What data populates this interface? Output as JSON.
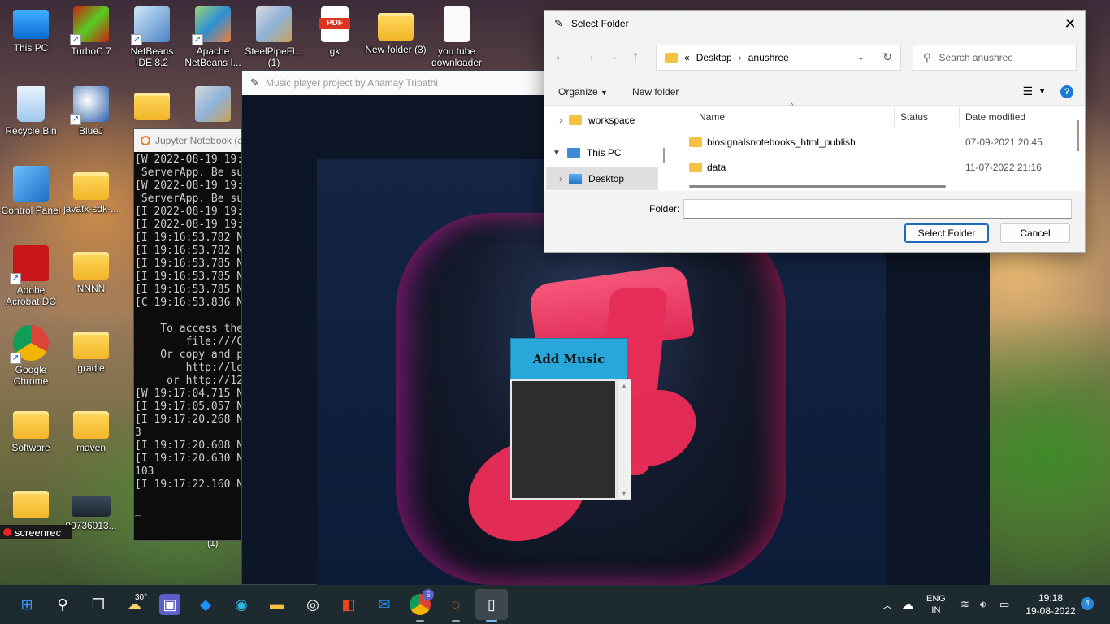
{
  "desktop": {
    "icons": [
      {
        "label": "This PC"
      },
      {
        "label": "TurboC 7"
      },
      {
        "label": "NetBeans IDE 8.2"
      },
      {
        "label": "Apache NetBeans I..."
      },
      {
        "label": "SteelPipeFl... (1)"
      },
      {
        "label": "gk",
        "badge": "PDF"
      },
      {
        "label": "New folder (3)"
      },
      {
        "label": "you tube downloader"
      },
      {
        "label": "Recycle Bin"
      },
      {
        "label": "BlueJ"
      },
      {
        "label": "Control Panel"
      },
      {
        "label": "javafx-sdk-..."
      },
      {
        "label": "Adobe Acrobat DC"
      },
      {
        "label": "NNNN"
      },
      {
        "label": "Google Chrome"
      },
      {
        "label": "gradle"
      },
      {
        "label": "Software"
      },
      {
        "label": "maven"
      },
      {
        "label": "90736013..."
      }
    ],
    "screenrec_label": "screenrec",
    "partial_label": "(1)"
  },
  "jupyter": {
    "title": "Jupyter Notebook (a",
    "lines": [
      "[W 2022-08-19 19:",
      " ServerApp. Be su",
      "[W 2022-08-19 19:",
      " ServerApp. Be su",
      "[I 2022-08-19 19:",
      "[I 2022-08-19 19:",
      "[I 19:16:53.782 N",
      "[I 19:16:53.782 N",
      "[I 19:16:53.785 N",
      "[I 19:16:53.785 N",
      "[I 19:16:53.785 N",
      "[C 19:16:53.836 N",
      "",
      "    To access the",
      "        file:///C",
      "    Or copy and p",
      "        http://lo",
      "     or http://12",
      "[W 19:17:04.715 N",
      "[I 19:17:05.057 N",
      "[I 19:17:20.268 N",
      "3",
      "[I 19:17:20.608 N",
      "[I 19:17:20.630 N",
      "103",
      "[I 19:17:22.160 N",
      "",
      "_"
    ]
  },
  "player": {
    "title": "Music player project by Anamay Tripathi",
    "add_music_label": "Add Music"
  },
  "dialog": {
    "title": "Select Folder",
    "breadcrumb": {
      "prefix": "«",
      "parts": [
        "Desktop",
        "anushree"
      ]
    },
    "search_placeholder": "Search anushree",
    "organize_label": "Organize",
    "new_folder_label": "New folder",
    "tree": [
      {
        "label": "workspace"
      },
      {
        "label": "This PC"
      },
      {
        "label": "Desktop"
      }
    ],
    "columns": {
      "name": "Name",
      "status": "Status",
      "date": "Date modified"
    },
    "files": [
      {
        "name": "biosignalsnotebooks_html_publish",
        "date": "07-09-2021 20:45"
      },
      {
        "name": "data",
        "date": "11-07-2022 21:16"
      }
    ],
    "folder_label": "Folder:",
    "folder_value": "",
    "select_label": "Select Folder",
    "cancel_label": "Cancel"
  },
  "taskbar": {
    "weather_temp": "30°",
    "chrome_badge": "5",
    "lang_top": "ENG",
    "lang_bottom": "IN",
    "time": "19:18",
    "date": "19-08-2022",
    "notifications": "4"
  }
}
